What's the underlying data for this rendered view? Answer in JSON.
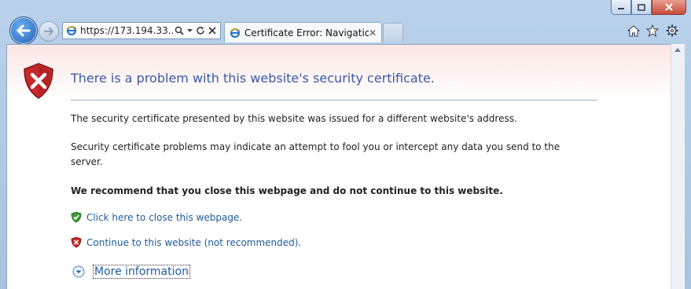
{
  "browser": {
    "address_url": "https://173.194.33....",
    "tab_title": "Certificate Error: Navigation...",
    "tab_close": "✕",
    "window_buttons": {
      "minimize": "minimize",
      "maximize": "maximize",
      "close": "close"
    },
    "command_icons": [
      "home-icon",
      "favorites-star-icon",
      "tools-gear-icon"
    ]
  },
  "page": {
    "heading": "There is a problem with this website's security certificate.",
    "paragraph1": "The security certificate presented by this website was issued for a different website's address.",
    "paragraph2": "Security certificate problems may indicate an attempt to fool you or intercept any data you send to the server.",
    "recommendation": "We recommend that you close this webpage and do not continue to this website.",
    "link_close": "Click here to close this webpage.",
    "link_continue": "Continue to this website (not recommended).",
    "more_info": "More information"
  },
  "colors": {
    "heading": "#3b59a6",
    "link": "#1f5a9c",
    "shield_red": "#c8282b",
    "shield_green": "#3c9a36"
  }
}
